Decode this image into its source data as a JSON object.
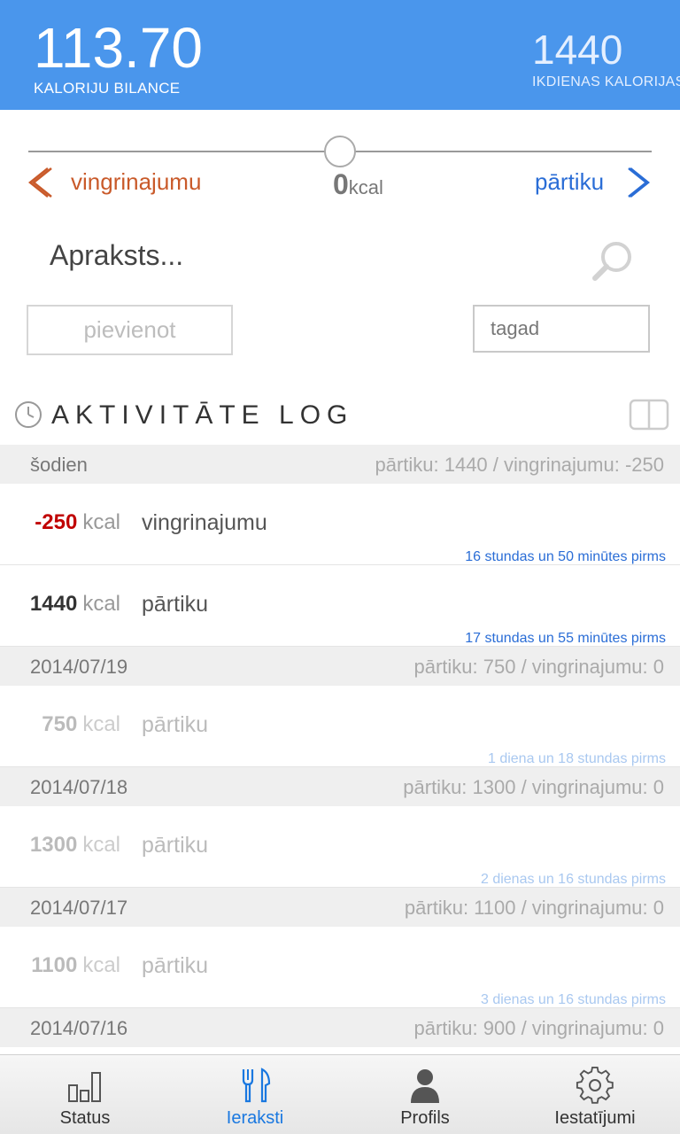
{
  "header": {
    "balance_value": "113.70",
    "balance_label": "KALORIJU BILANCE",
    "daily_value": "1440",
    "daily_label": "IKDIENAS KALORIJAS"
  },
  "entry_form": {
    "left_label": "vingrinajumu",
    "kcal_value": "0",
    "kcal_unit": "kcal",
    "right_label": "pārtiku",
    "description_placeholder": "Apraksts...",
    "add_button_label": "pievienot",
    "time_value": "tagad"
  },
  "log": {
    "title": "AKTIVITĀTE LOG",
    "days": [
      {
        "date": "šodien",
        "summary": "pārtiku: 1440 / vingrinajumu: -250",
        "entries": [
          {
            "value": "-250",
            "unit": "kcal",
            "desc": "vingrinajumu",
            "ago": "16 stundas un 50 minūtes pirms"
          },
          {
            "value": "1440",
            "unit": "kcal",
            "desc": "pārtiku",
            "ago": "17 stundas un 55 minūtes pirms"
          }
        ]
      },
      {
        "date": "2014/07/19",
        "summary": "pārtiku: 750 / vingrinajumu: 0",
        "entries": [
          {
            "value": "750",
            "unit": "kcal",
            "desc": "pārtiku",
            "ago": "1 diena un 18 stundas pirms"
          }
        ]
      },
      {
        "date": "2014/07/18",
        "summary": "pārtiku: 1300 / vingrinajumu: 0",
        "entries": [
          {
            "value": "1300",
            "unit": "kcal",
            "desc": "pārtiku",
            "ago": "2 dienas un 16 stundas pirms"
          }
        ]
      },
      {
        "date": "2014/07/17",
        "summary": "pārtiku: 1100 / vingrinajumu: 0",
        "entries": [
          {
            "value": "1100",
            "unit": "kcal",
            "desc": "pārtiku",
            "ago": "3 dienas un 16 stundas pirms"
          }
        ]
      },
      {
        "date": "2014/07/16",
        "summary": "pārtiku: 900 / vingrinajumu: 0",
        "entries": []
      }
    ]
  },
  "tabs": [
    {
      "label": "Status",
      "icon": "bar-chart-icon"
    },
    {
      "label": "Ieraksti",
      "icon": "fork-knife-icon"
    },
    {
      "label": "Profils",
      "icon": "person-icon"
    },
    {
      "label": "Iestatījumi",
      "icon": "gear-icon"
    }
  ],
  "colors": {
    "header_bg": "#4a96ec",
    "exercise": "#c95a2a",
    "food": "#2a6dd6",
    "negative": "#c00000",
    "active_tab": "#1a78e0"
  }
}
